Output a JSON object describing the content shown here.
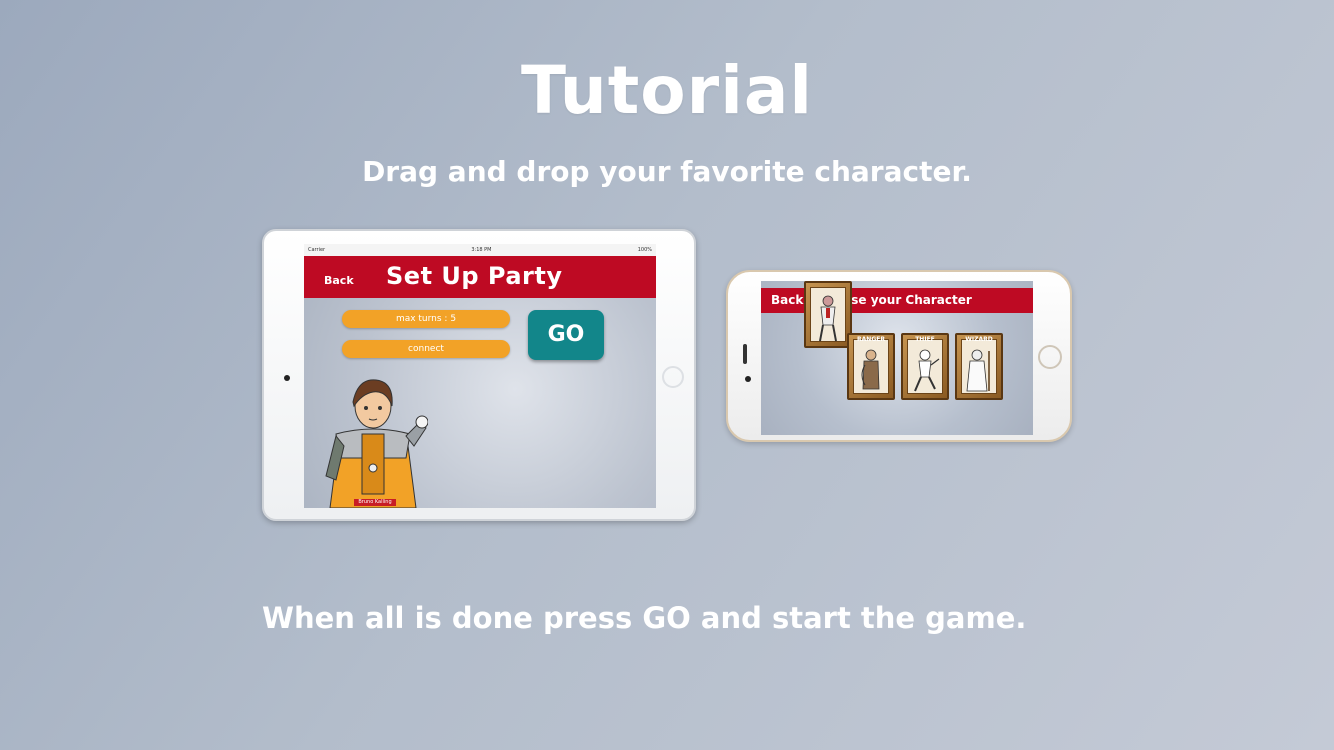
{
  "header": {
    "title": "Tutorial",
    "subtitle": "Drag and drop your favorite character."
  },
  "footer": {
    "instruction": "When all is done press GO and start the game."
  },
  "ipad_screen": {
    "status_left": "Carrier",
    "status_time": "3:18 PM",
    "status_right": "100%",
    "back_label": "Back",
    "title": "Set Up Party",
    "max_turns_label": "max turns : 5",
    "connect_label": "connect",
    "go_label": "GO",
    "hero_name": "Bruno Kalling"
  },
  "iphone_screen": {
    "back_label": "Back",
    "title": "ose your Character",
    "cards": [
      {
        "name": "RANGER"
      },
      {
        "name": "THIEF"
      },
      {
        "name": "WIZARD"
      }
    ]
  },
  "colors": {
    "banner_red": "#be0a23",
    "pill_orange": "#f2a227",
    "go_teal": "#12868a",
    "card_gold": "#c69450"
  }
}
